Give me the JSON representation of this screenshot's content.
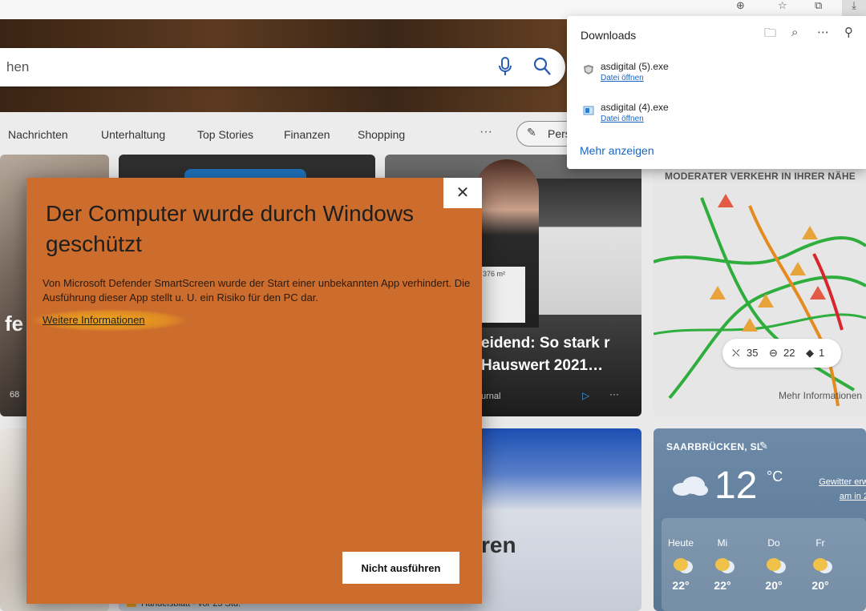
{
  "browser": {
    "toolbar_icons": [
      "profile-icon",
      "favorites-icon",
      "collections-icon",
      "downloads-icon"
    ]
  },
  "search": {
    "placeholder_fragment": "hen"
  },
  "nav": {
    "items": [
      "Nachrichten",
      "Unterhaltung",
      "Top Stories",
      "Finanzen",
      "Shopping"
    ],
    "more": "···",
    "personalize_fragment": "Pers"
  },
  "left_card": {
    "fragment": "fe",
    "count": "68"
  },
  "news_card": {
    "paper_text": "376 m²",
    "title": "eidend: So stark r Hauswert 2021…",
    "source": "urnal"
  },
  "bottom_card": {
    "big_text": "ren",
    "source": "Handelsblatt · vor 23 Std."
  },
  "traffic": {
    "title": "MODERATER VERKEHR IN IHRER NÄHE",
    "incidents": "35",
    "closures": "22",
    "other": "1",
    "more_info": "Mehr Informationen"
  },
  "weather": {
    "location": "SAARBRÜCKEN, SL",
    "temp": "12",
    "unit": "°C",
    "alert_line1": "Gewitter erw",
    "alert_line2": "am in 2",
    "days": [
      {
        "label": "Heute",
        "temp": "22°"
      },
      {
        "label": "Mi",
        "temp": "22°"
      },
      {
        "label": "Do",
        "temp": "20°"
      },
      {
        "label": "Fr",
        "temp": "20°"
      }
    ]
  },
  "downloads": {
    "title": "Downloads",
    "items": [
      {
        "name": "asdigital (5).exe",
        "action": "Datei öffnen"
      },
      {
        "name": "asdigital (4).exe",
        "action": "Datei öffnen"
      }
    ],
    "more": "Mehr anzeigen"
  },
  "smartscreen": {
    "title": "Der Computer wurde durch Windows geschützt",
    "body": "Von Microsoft Defender SmartScreen wurde der Start einer unbekannten App verhindert. Die Ausführung dieser App stellt u. U. ein Risiko für den PC dar.",
    "more_info_link": "Weitere Informationen",
    "dont_run_button": "Nicht ausführen",
    "close_glyph": "✕",
    "accent_color": "#cc6d2e"
  }
}
